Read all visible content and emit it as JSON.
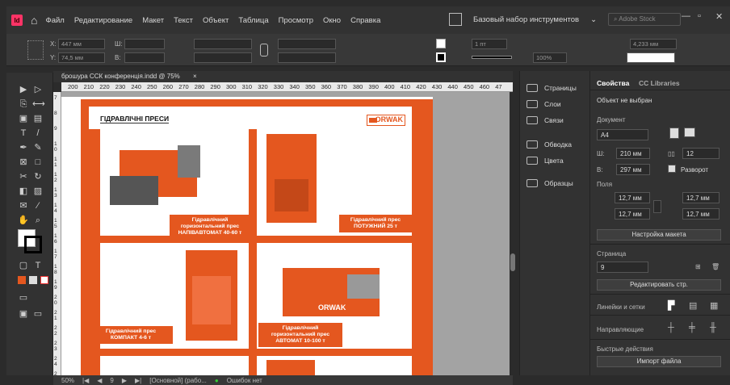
{
  "menubar": {
    "logo": "Id",
    "items": [
      "Файл",
      "Редактирование",
      "Макет",
      "Текст",
      "Объект",
      "Таблица",
      "Просмотр",
      "Окно",
      "Справка"
    ],
    "workspace": "Базовый набор инструментов",
    "search_placeholder": "Adobe Stock"
  },
  "control": {
    "x_label": "X:",
    "x_value": "447 мм",
    "y_label": "Y:",
    "y_value": "74,5 мм",
    "w_label": "Ш:",
    "h_label": "В:",
    "stroke_weight": "1 пт",
    "opacity": "100%",
    "width_value": "4,233 мм"
  },
  "document": {
    "tab_title": "брошура ССК конференція.indd @ 75%",
    "close": "×",
    "ruler_h": [
      "200",
      "210",
      "220",
      "230",
      "240",
      "250",
      "260",
      "270",
      "280",
      "290",
      "300",
      "310",
      "320",
      "330",
      "340",
      "350",
      "360",
      "370",
      "380",
      "390",
      "400",
      "410",
      "420",
      "430",
      "440",
      "450",
      "460",
      "47"
    ],
    "ruler_v": [
      "7",
      "8",
      "9",
      "1 0",
      "1 1",
      "1 2",
      "1 3",
      "1 4",
      "1 5",
      "1 6",
      "1 7",
      "1 8",
      "1 9",
      "2 0",
      "2 1",
      "2 2",
      "2 3",
      "2 4",
      "2 5"
    ],
    "header": "ГІДРАВЛІЧНІ ПРЕСИ",
    "brand": "ORWAK",
    "captions": [
      "Гідравлічний горизонтальний прес НАПІВАВТОМАТ 40-60 т",
      "Гідравлічний прес ПОТУЖНИЙ 25 т",
      "Гідравлічний прес КОМПАКТ 4-6 т",
      "Гідравлічний горизонтальний прес АВТОМАТ 10-100 т"
    ],
    "machine_label": "ORWAK"
  },
  "status": {
    "zoom": "50%",
    "page": "9",
    "style": "[Основной] (рабо...",
    "errors": "Ошибок нет"
  },
  "dock": {
    "items": [
      "Страницы",
      "Слои",
      "Связи",
      "Обводка",
      "Цвета",
      "Образцы"
    ]
  },
  "props": {
    "tab_properties": "Свойства",
    "tab_cc": "CC Libraries",
    "no_selection": "Объект не выбран",
    "document_label": "Документ",
    "page_size": "A4",
    "width_label": "Ш:",
    "width_value": "210 мм",
    "height_label": "В:",
    "height_value": "297 мм",
    "pages_value": "12",
    "spread_label": "Разворот",
    "margins_label": "Поля",
    "margin_top": "12,7 мм",
    "margin_bottom": "12,7 мм",
    "margin_left": "12,7 мм",
    "margin_right": "12,7 мм",
    "layout_button": "Настройка макета",
    "page_label": "Страница",
    "page_value": "9",
    "edit_page_button": "Редактировать стр.",
    "rulers_label": "Линейки и сетки",
    "guides_label": "Направляющие",
    "quick_actions_label": "Быстрые действия",
    "import_button": "Импорт файла"
  },
  "colors": {
    "accent": "#e4571f",
    "panel": "#323232",
    "canvas": "#a3a3a3"
  }
}
